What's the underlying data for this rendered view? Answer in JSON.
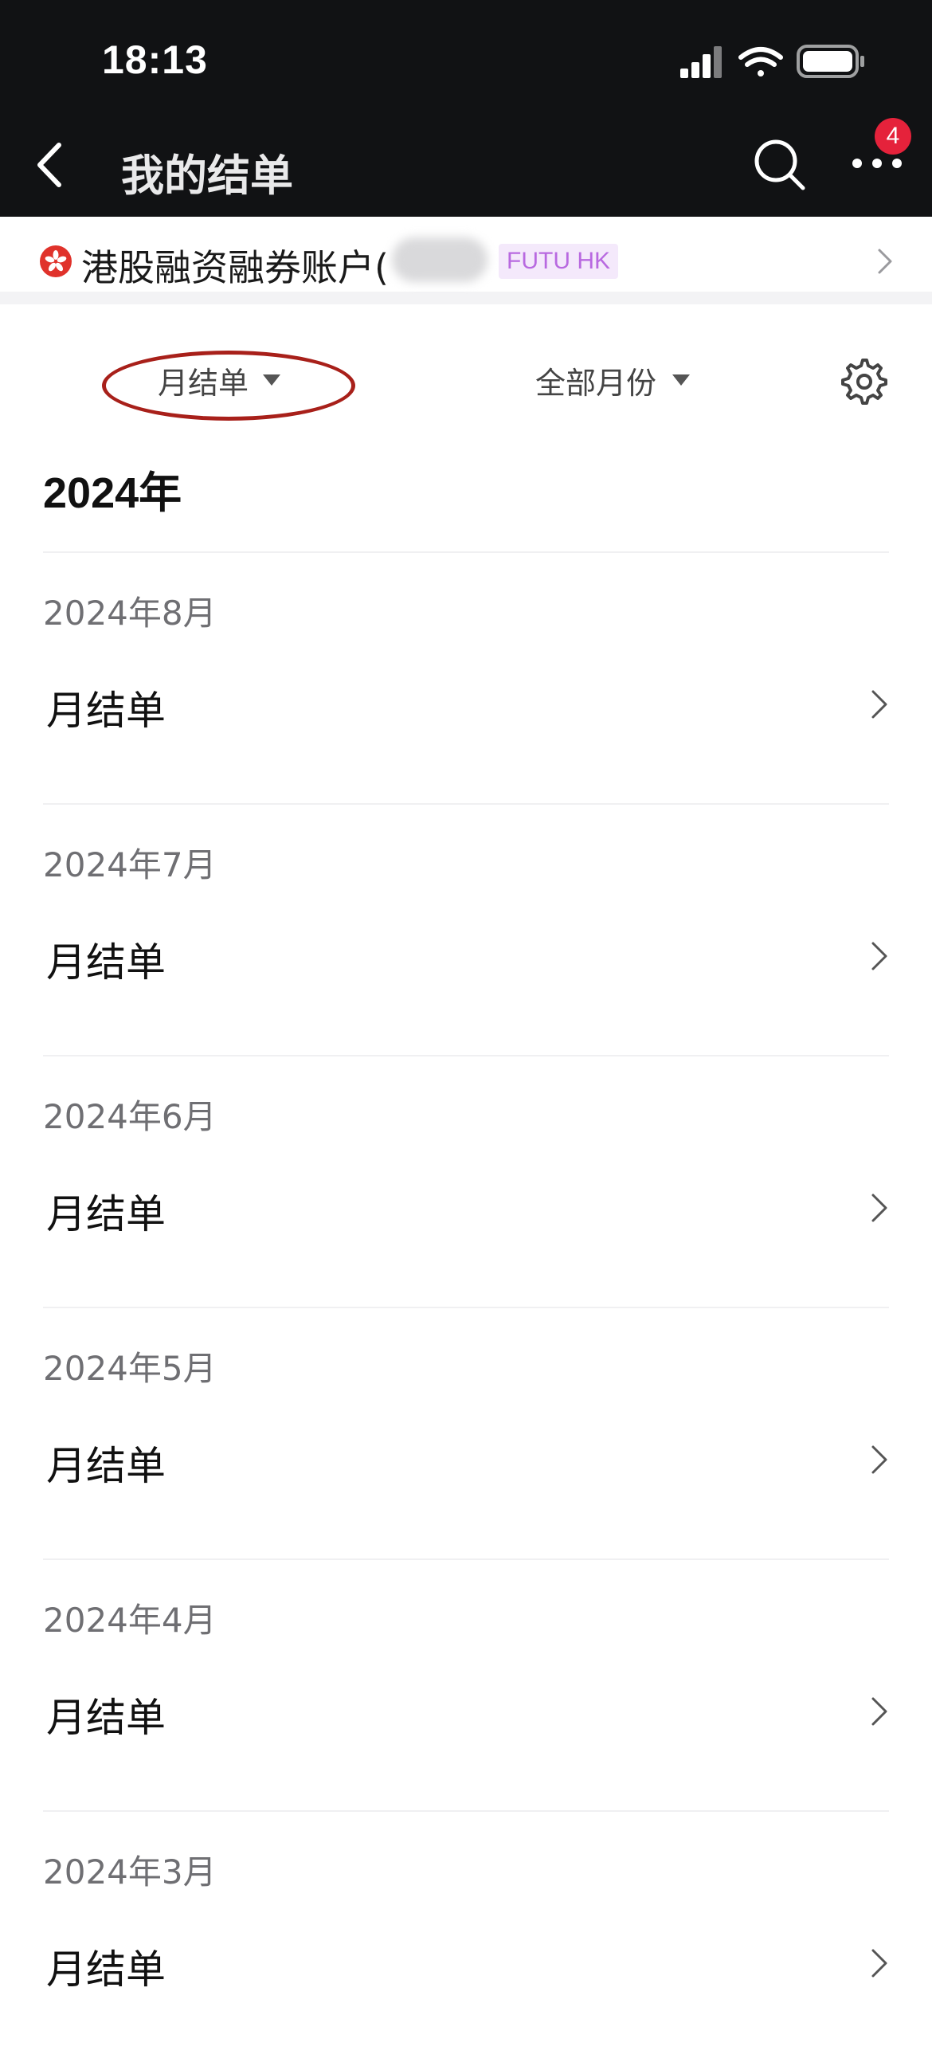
{
  "status_bar": {
    "time": "18:13"
  },
  "nav": {
    "title": "我的结单",
    "notification_count": "4",
    "icons": {
      "back": "chevron-left-icon",
      "search": "search-icon",
      "more": "more-dots-icon"
    }
  },
  "account": {
    "name": "港股融资融券账户(",
    "broker": "FUTU HK",
    "region_flag": "hong-kong-flag-icon"
  },
  "filters": {
    "statement_type": "月结单",
    "month_range": "全部月份",
    "settings_icon": "gear-icon"
  },
  "annotation": {
    "color": "#a8201a"
  },
  "year": "2024年",
  "statements": [
    {
      "date": "2024年8月",
      "label": "月结单"
    },
    {
      "date": "2024年7月",
      "label": "月结单"
    },
    {
      "date": "2024年6月",
      "label": "月结单"
    },
    {
      "date": "2024年5月",
      "label": "月结单"
    },
    {
      "date": "2024年4月",
      "label": "月结单"
    },
    {
      "date": "2024年3月",
      "label": "月结单"
    }
  ],
  "colors": {
    "topbar": "#111214",
    "badge": "#e5223b",
    "broker_tag_text": "#b869e0",
    "broker_tag_bg": "#f4e9fb"
  }
}
